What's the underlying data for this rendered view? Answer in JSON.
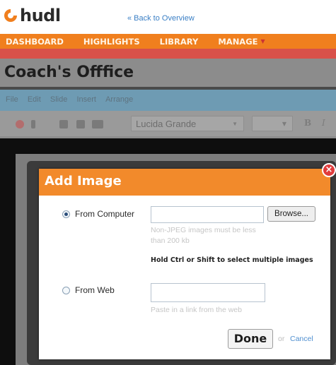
{
  "brand": {
    "name": "hudl",
    "accent": "#f07f1e"
  },
  "header": {
    "back_link": "« Back to Overview"
  },
  "nav": {
    "items": [
      "DASHBOARD",
      "HIGHLIGHTS",
      "LIBRARY",
      "MANAGE"
    ]
  },
  "app": {
    "title": "Coach's Offfice",
    "menu": [
      "File",
      "Edit",
      "Slide",
      "Insert",
      "Arrange"
    ],
    "font_family": "Lucida Grande",
    "bold_label": "B",
    "italic_label": "I"
  },
  "modal": {
    "title": "Add Image",
    "close_icon": "close-icon",
    "from_computer": {
      "label": "From Computer",
      "selected": true,
      "browse_label": "Browse...",
      "hint": "Non-JPEG images must be less than 200 kb",
      "multi_note": "Hold Ctrl or Shift to select multiple images"
    },
    "from_web": {
      "label": "From Web",
      "selected": false,
      "hint": "Paste in a link from the web"
    },
    "done_label": "Done",
    "or_text": "or",
    "cancel_label": "Cancel"
  }
}
